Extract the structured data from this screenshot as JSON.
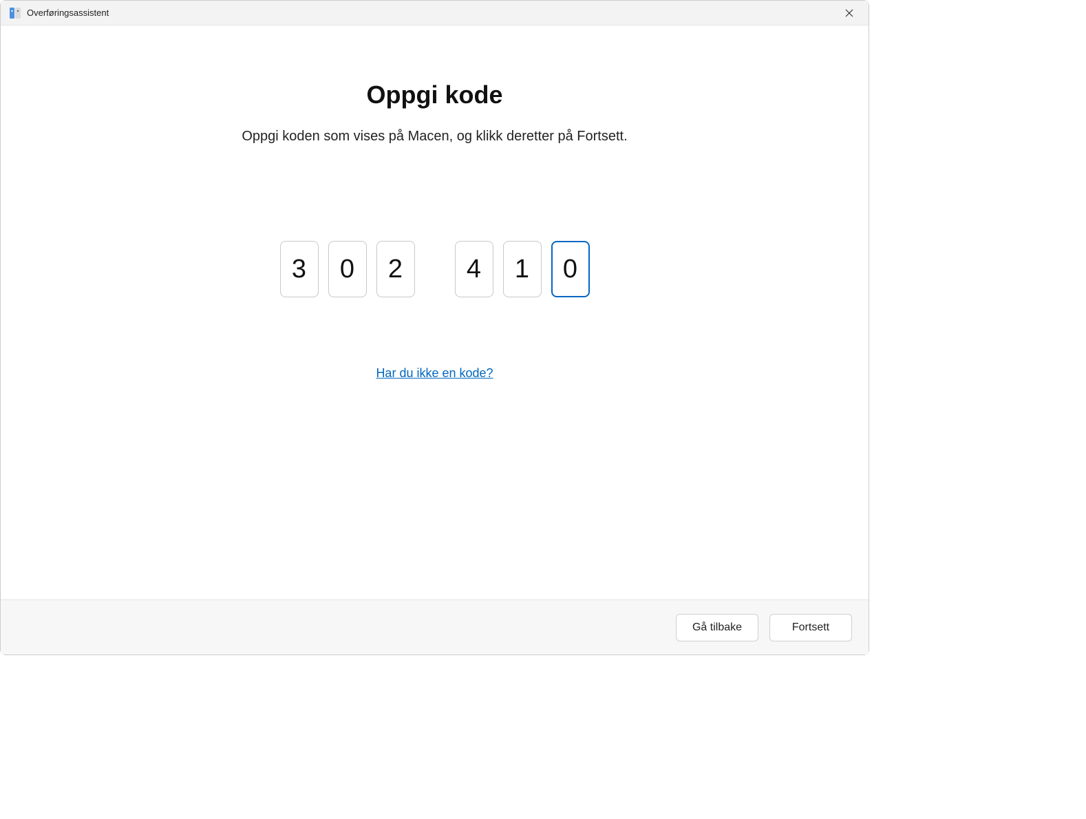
{
  "titlebar": {
    "title": "Overføringsassistent"
  },
  "main": {
    "heading": "Oppgi kode",
    "instruction": "Oppgi koden som vises på Macen, og klikk deretter på Fortsett.",
    "code": [
      "3",
      "0",
      "2",
      "4",
      "1",
      "0"
    ],
    "focused_index": 5,
    "help_link": "Har du ikke en kode?"
  },
  "footer": {
    "back_label": "Gå tilbake",
    "continue_label": "Fortsett"
  }
}
